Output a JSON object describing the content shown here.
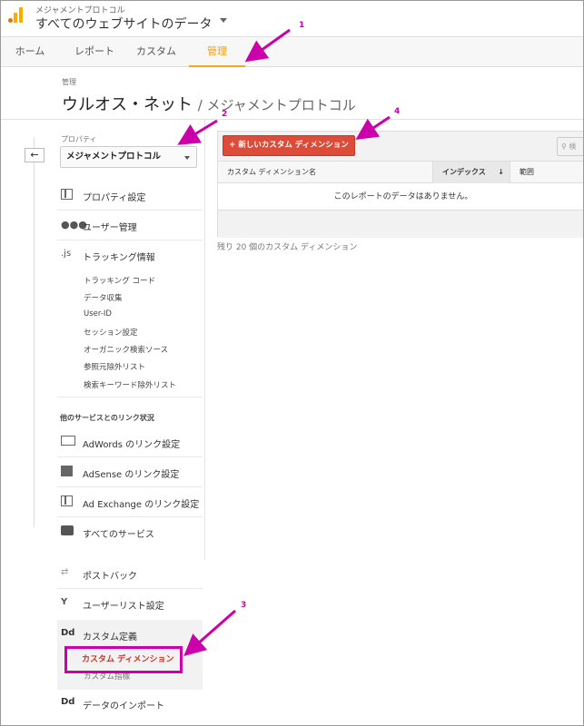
{
  "account": {
    "small_label": "メジャメントプロトコル",
    "view_name": "すべてのウェブサイトのデータ"
  },
  "nav": {
    "tabs": [
      {
        "label": "ホーム"
      },
      {
        "label": "レポート"
      },
      {
        "label": "カスタム"
      },
      {
        "label": "管理",
        "active": true
      }
    ]
  },
  "header": {
    "small": "管理",
    "account_name": "ウルオス・ネット",
    "property_name": "/ メジャメントプロトコル"
  },
  "sidebar": {
    "property_label": "プロパティ",
    "property_value": "メジャメントプロトコル",
    "items": [
      {
        "label": "プロパティ設定",
        "icon": "property-settings-icon"
      },
      {
        "label": "ユーザー管理",
        "icon": "users-icon"
      },
      {
        "label": "トラッキング情報",
        "icon": "js-icon",
        "icon_text": ".js"
      }
    ],
    "tracking_sub": [
      "トラッキング コード",
      "データ収集",
      "User-ID",
      "セッション設定",
      "オーガニック検索ソース",
      "参照元除外リスト",
      "検索キーワード除外リスト"
    ],
    "section_heading": "他のサービスとのリンク状況",
    "link_items": [
      {
        "label": "AdWords のリンク設定",
        "icon": "adwords-icon"
      },
      {
        "label": "AdSense のリンク設定",
        "icon": "adsense-icon"
      },
      {
        "label": "Ad Exchange のリンク設定",
        "icon": "adexchange-icon"
      },
      {
        "label": "すべてのサービス",
        "icon": "all-services-icon"
      }
    ],
    "other_items": [
      {
        "label": "ポストバック",
        "icon": "postback-icon"
      },
      {
        "label": "ユーザーリスト設定",
        "icon": "user-list-icon"
      },
      {
        "label": "カスタム定義",
        "icon": "custom-definitions-icon",
        "icon_text": "Dd"
      }
    ],
    "custom_sub": [
      "カスタム ディメンション",
      "カスタム指標"
    ],
    "import_item": {
      "label": "データのインポート",
      "icon_text": "Dd"
    }
  },
  "main": {
    "new_button": "+ 新しいカスタム ディメンション",
    "search_placeholder": "検",
    "columns": [
      "カスタム ディメンション名",
      "インデックス",
      "範囲"
    ],
    "sort_arrow": "↓",
    "empty_message": "このレポートのデータはありません。",
    "remaining": "残り 20 個のカスタム ディメンション"
  },
  "annotations": [
    "1",
    "2",
    "3",
    "4"
  ],
  "colors": {
    "accent": "#f5a623",
    "annotation": "#cc00aa",
    "button": "#dd4b39"
  }
}
